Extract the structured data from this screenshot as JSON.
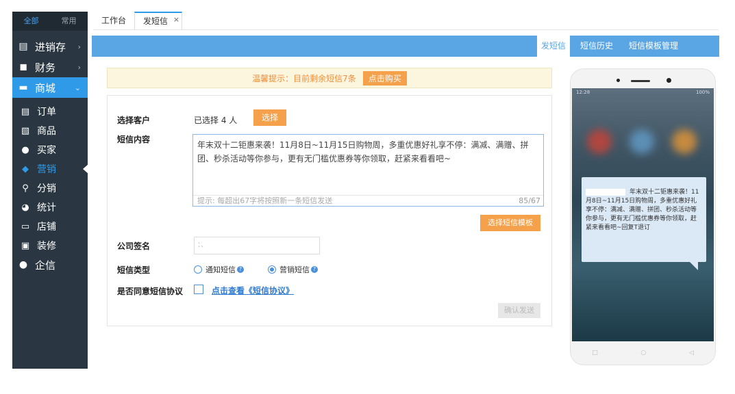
{
  "sidebar": {
    "tabs": [
      {
        "label": "全部"
      },
      {
        "label": "常用"
      }
    ],
    "menu": [
      {
        "label": "进销存"
      },
      {
        "label": "财务"
      },
      {
        "label": "商城"
      }
    ],
    "submenu": [
      {
        "label": "订单"
      },
      {
        "label": "商品"
      },
      {
        "label": "买家"
      },
      {
        "label": "营销"
      },
      {
        "label": "分销"
      },
      {
        "label": "统计"
      },
      {
        "label": "店铺"
      },
      {
        "label": "装修"
      }
    ],
    "extra": {
      "label": "企信"
    },
    "colors": {
      "bg": "#2a3742",
      "active": "#2e9ae8"
    }
  },
  "tabs": [
    {
      "label": "工作台"
    },
    {
      "label": "发短信",
      "close": "×"
    }
  ],
  "header_tabs": [
    {
      "label": "发短信"
    },
    {
      "label": "短信历史"
    },
    {
      "label": "短信模板管理"
    }
  ],
  "tip": {
    "text": "温馨提示：目前剩余短信7条",
    "buy_label": "点击购买"
  },
  "form": {
    "customer_label": "选择客户",
    "customer_value": "已选择 4 人",
    "customer_button": "选择",
    "content_label": "短信内容",
    "content_text": "年末双十二钜惠来袭！11月8日~11月15日购物周，多重优惠好礼享不停：满减、满赠、拼团、秒杀活动等你参与，更有无门槛优惠券等你领取，赶紧来看看吧~",
    "content_hint": "提示: 每超出67字将按照新一条短信发送",
    "content_count": "85/67",
    "template_button": "选择短信模板",
    "signature_label": "公司签名",
    "signature_value": "：、",
    "type_label": "短信类型",
    "type_options": [
      {
        "label": "通知短信",
        "selected": false
      },
      {
        "label": "营销短信",
        "selected": true
      }
    ],
    "agreement_label": "是否同意短信协议",
    "agreement_link": "点击查看《短信协议》",
    "confirm_button": "确认发送"
  },
  "phone": {
    "time": "12:28",
    "battery": "100%",
    "preview_text": "年末双十二钜惠来袭！11月8日~11月15日购物周，多重优惠好礼享不停：满减、满赠、拼团、秒杀活动等你参与，更有无门槛优惠券等你领取，赶紧来看看吧~回复T退订"
  },
  "colors": {
    "accent": "#5aa5e3",
    "orange": "#f5a04a"
  }
}
